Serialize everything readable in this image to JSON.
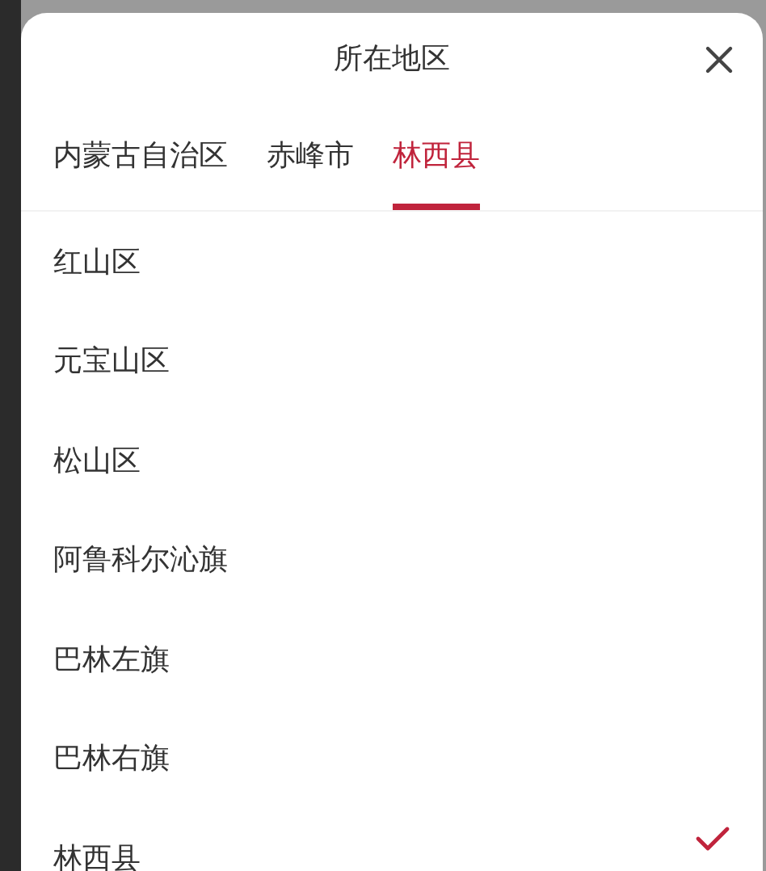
{
  "sheet": {
    "title": "所在地区"
  },
  "tabs": [
    {
      "label": "内蒙古自治区",
      "selected": false
    },
    {
      "label": "赤峰市",
      "selected": false
    },
    {
      "label": "林西县",
      "selected": true
    }
  ],
  "items": [
    {
      "label": "红山区",
      "selected": false
    },
    {
      "label": "元宝山区",
      "selected": false
    },
    {
      "label": "松山区",
      "selected": false
    },
    {
      "label": "阿鲁科尔沁旗",
      "selected": false
    },
    {
      "label": "巴林左旗",
      "selected": false
    },
    {
      "label": "巴林右旗",
      "selected": false
    },
    {
      "label": "林西县",
      "selected": true
    }
  ]
}
